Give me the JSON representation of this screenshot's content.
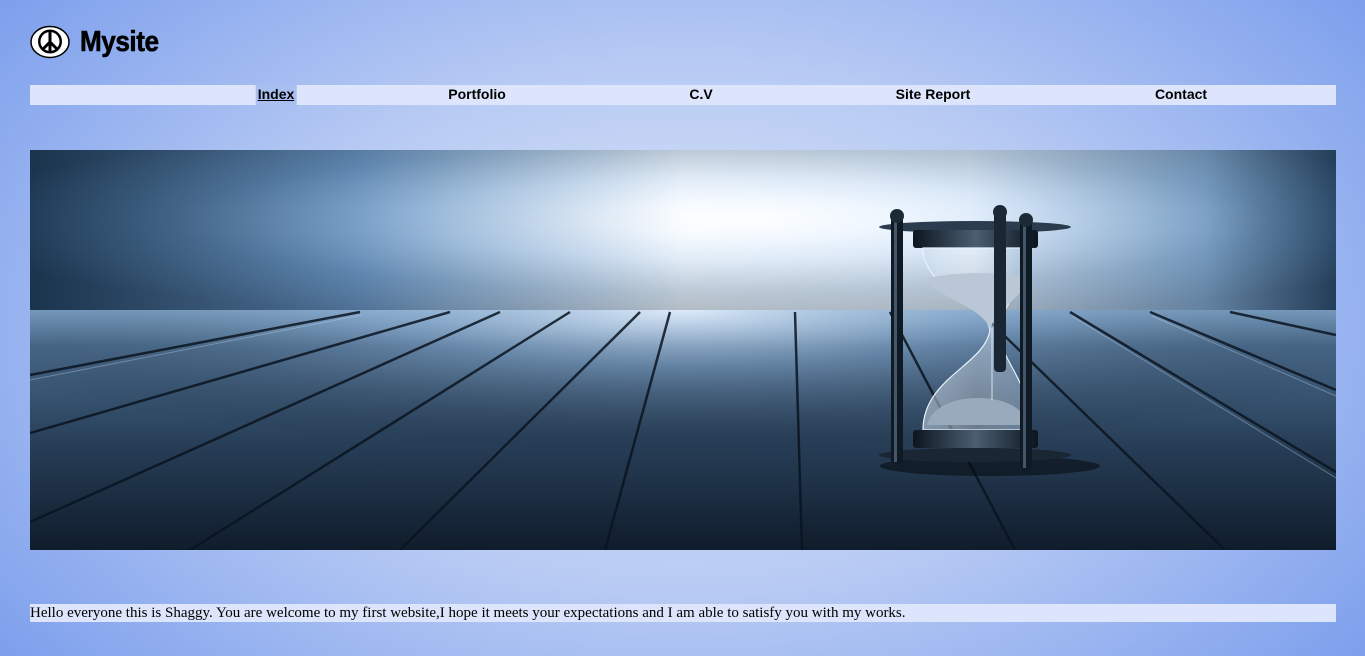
{
  "header": {
    "logo_icon": "peace-sign-icon",
    "title": "Mysite"
  },
  "nav": {
    "items": [
      {
        "label": "Index",
        "active": true
      },
      {
        "label": "Portfolio"
      },
      {
        "label": "C.V"
      },
      {
        "label": "Site Report"
      },
      {
        "label": "Contact"
      }
    ]
  },
  "hero": {
    "image": "hourglass-on-wooden-floor"
  },
  "intro": {
    "text": "Hello everyone this is Shaggy. You are welcome to my first website,I hope it meets your expectations and I am able to satisfy you with my works."
  },
  "colors": {
    "nav_bg": "#dce5fb",
    "active_bg": "#a9bff0",
    "page_bg": "#8aa9ee"
  }
}
